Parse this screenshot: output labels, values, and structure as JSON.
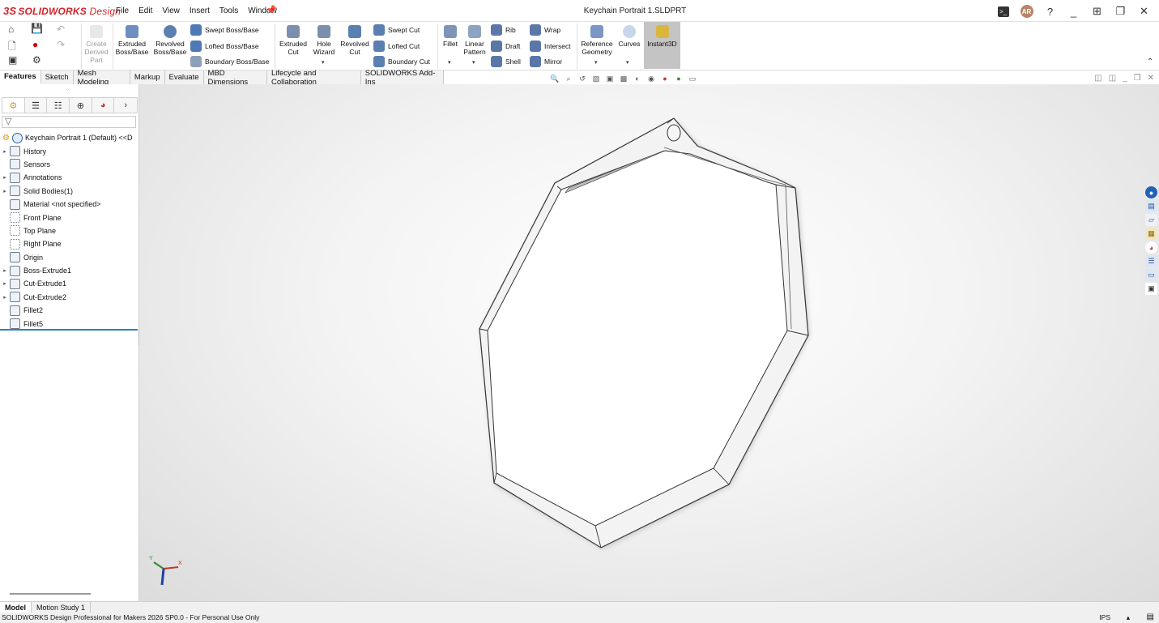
{
  "app": {
    "brand_ds": "3S",
    "brand": "SOLIDWORKS",
    "brand_suffix": "Design",
    "window_title": "Keychain Portrait 1.SLDPRT",
    "avatar": "AR"
  },
  "menu": [
    "File",
    "Edit",
    "View",
    "Insert",
    "Tools",
    "Window"
  ],
  "ribbon": {
    "create_derived": "Create Derived Part",
    "extruded_boss": "Extruded Boss/Base",
    "revolved_boss": "Revolved Boss/Base",
    "swept_boss": "Swept Boss/Base",
    "lofted_boss": "Lofted Boss/Base",
    "boundary_boss": "Boundary Boss/Base",
    "extruded_cut": "Extruded Cut",
    "hole_wizard": "Hole Wizard",
    "revolved_cut": "Revolved Cut",
    "swept_cut": "Swept Cut",
    "lofted_cut": "Lofted Cut",
    "boundary_cut": "Boundary Cut",
    "fillet": "Fillet",
    "linear_pattern": "Linear Pattern",
    "rib": "Rib",
    "draft": "Draft",
    "shell": "Shell",
    "wrap": "Wrap",
    "intersect": "Intersect",
    "mirror": "Mirror",
    "reference_geometry": "Reference Geometry",
    "curves": "Curves",
    "instant3d": "Instant3D"
  },
  "cmgr_tabs": [
    "Features",
    "Sketch",
    "Mesh Modeling",
    "Markup",
    "Evaluate",
    "MBD Dimensions",
    "Lifecycle and Collaboration",
    "SOLIDWORKS Add-Ins"
  ],
  "tree": {
    "root": "Keychain Portrait 1 (Default) <<D",
    "items": [
      {
        "label": "History",
        "arrow": true
      },
      {
        "label": "Sensors",
        "arrow": false
      },
      {
        "label": "Annotations",
        "arrow": true
      },
      {
        "label": "Solid Bodies(1)",
        "arrow": true
      },
      {
        "label": "Material <not specified>",
        "arrow": false
      },
      {
        "label": "Front Plane",
        "arrow": false,
        "plane": true
      },
      {
        "label": "Top Plane",
        "arrow": false,
        "plane": true
      },
      {
        "label": "Right Plane",
        "arrow": false,
        "plane": true
      },
      {
        "label": "Origin",
        "arrow": false
      },
      {
        "label": "Boss-Extrude1",
        "arrow": true
      },
      {
        "label": "Cut-Extrude1",
        "arrow": true
      },
      {
        "label": "Cut-Extrude2",
        "arrow": true
      },
      {
        "label": "Fillet2",
        "arrow": false
      },
      {
        "label": "Fillet5",
        "arrow": false
      }
    ]
  },
  "bottom_tabs": [
    "Model",
    "Motion Study 1"
  ],
  "status": {
    "text": "SOLIDWORKS Design Professional for Makers 2026 SP0.0 - For Personal Use Only",
    "units": "IPS",
    "caret": "▴"
  },
  "triad": {
    "x": "X",
    "y": "Y"
  }
}
